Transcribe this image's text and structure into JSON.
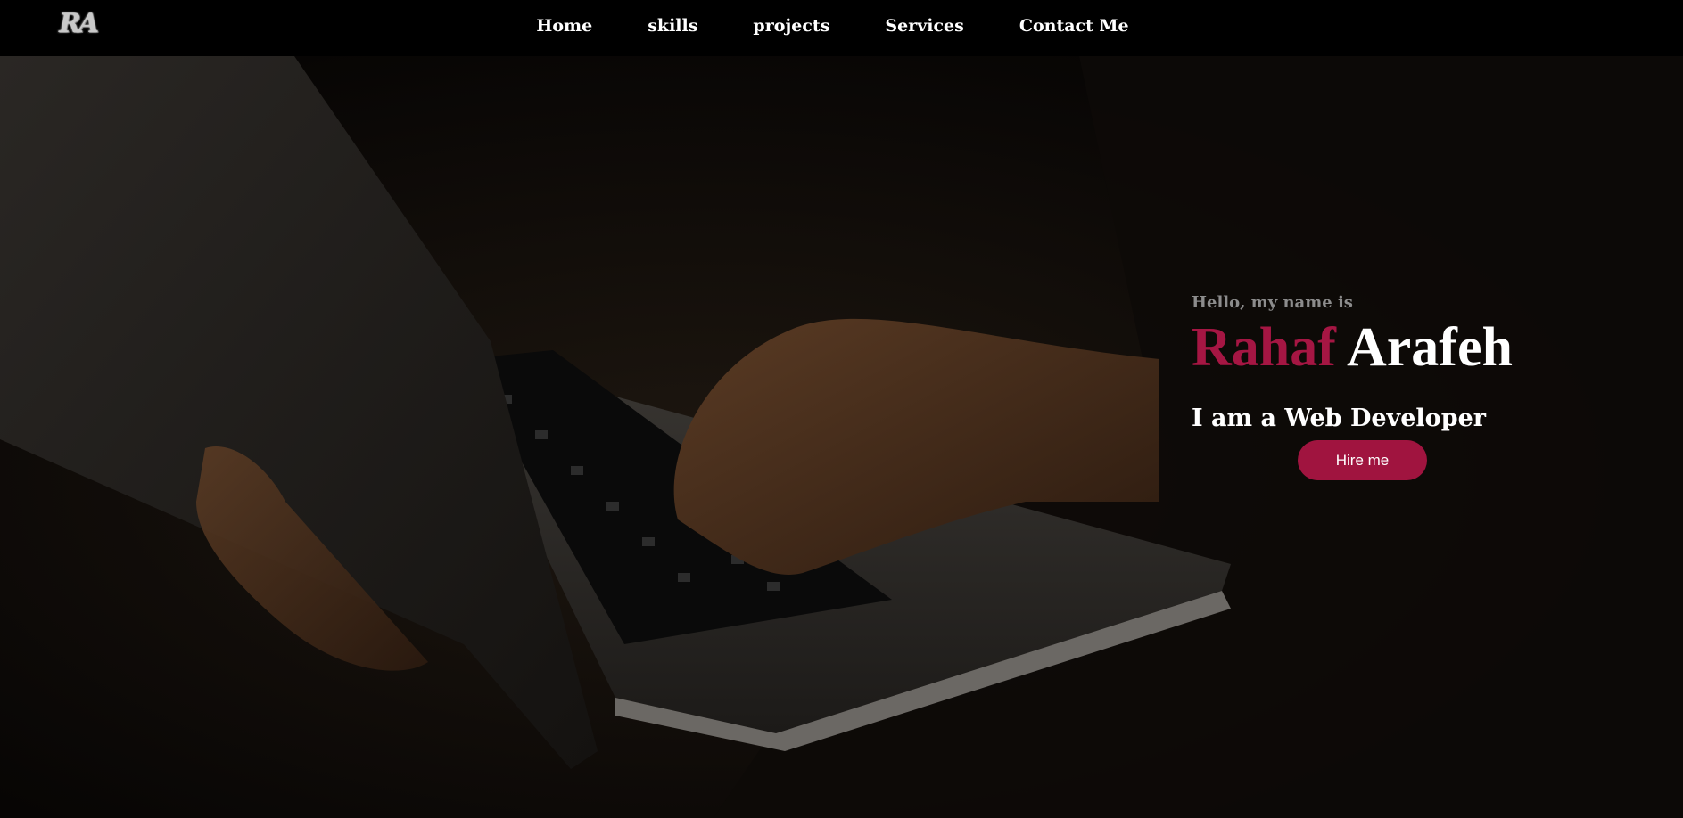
{
  "nav": {
    "logo": "RA",
    "links": [
      "Home",
      "skills",
      "projects",
      "Services",
      "Contact Me"
    ]
  },
  "hero": {
    "greeting": "Hello, my name is",
    "first_name": "Rahaf",
    "last_name": "Arafeh",
    "tagline": "I am a Web Developer",
    "cta_label": "Hire me",
    "background_image": "person-typing-on-laptop-photo"
  },
  "colors": {
    "accent": "#a51643",
    "nav_bg": "#000000",
    "text": "#ffffff",
    "muted": "#8c8c8c"
  }
}
